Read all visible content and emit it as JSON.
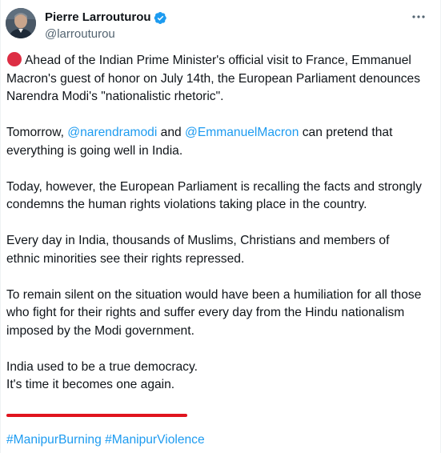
{
  "author": {
    "name": "Pierre Larrouturou",
    "handle": "@larrouturou"
  },
  "colors": {
    "link": "#1d9bf0",
    "verified": "#1d9bf0",
    "emoji_red": "#dd2e44",
    "underline": "#e0141e"
  },
  "icons": {
    "verified": "verified-badge-icon",
    "more": "more-dots-icon",
    "red_circle": "red-circle-emoji"
  },
  "tweet": {
    "p1": "Ahead of the Indian Prime Minister's official visit to France, Emmanuel Macron's guest of honor on July 14th, the European Parliament denounces Narendra Modi's \"nationalistic rhetoric\".",
    "p2_pre": "Tomorrow, ",
    "p2_mention1": "@narendramodi",
    "p2_mid": " and ",
    "p2_mention2": "@EmmanuelMacron",
    "p2_post": " can pretend that everything is going well in India.",
    "p3": "Today, however, the European Parliament is recalling the facts and strongly condemns the human rights violations taking place in the country.",
    "p4": "Every day in India, thousands of Muslims, Christians and members of ethnic minorities see their rights repressed.",
    "p5": "To remain silent on the situation would have been a humiliation for all those who fight for their rights and suffer every day from the Hindu nationalism imposed by the Modi government.",
    "p6_line1": "India used to be a true democracy.",
    "p6_line2": "It's time it becomes one again.",
    "hashtag1": "#ManipurBurning",
    "hashtag2": "#ManipurViolence"
  }
}
